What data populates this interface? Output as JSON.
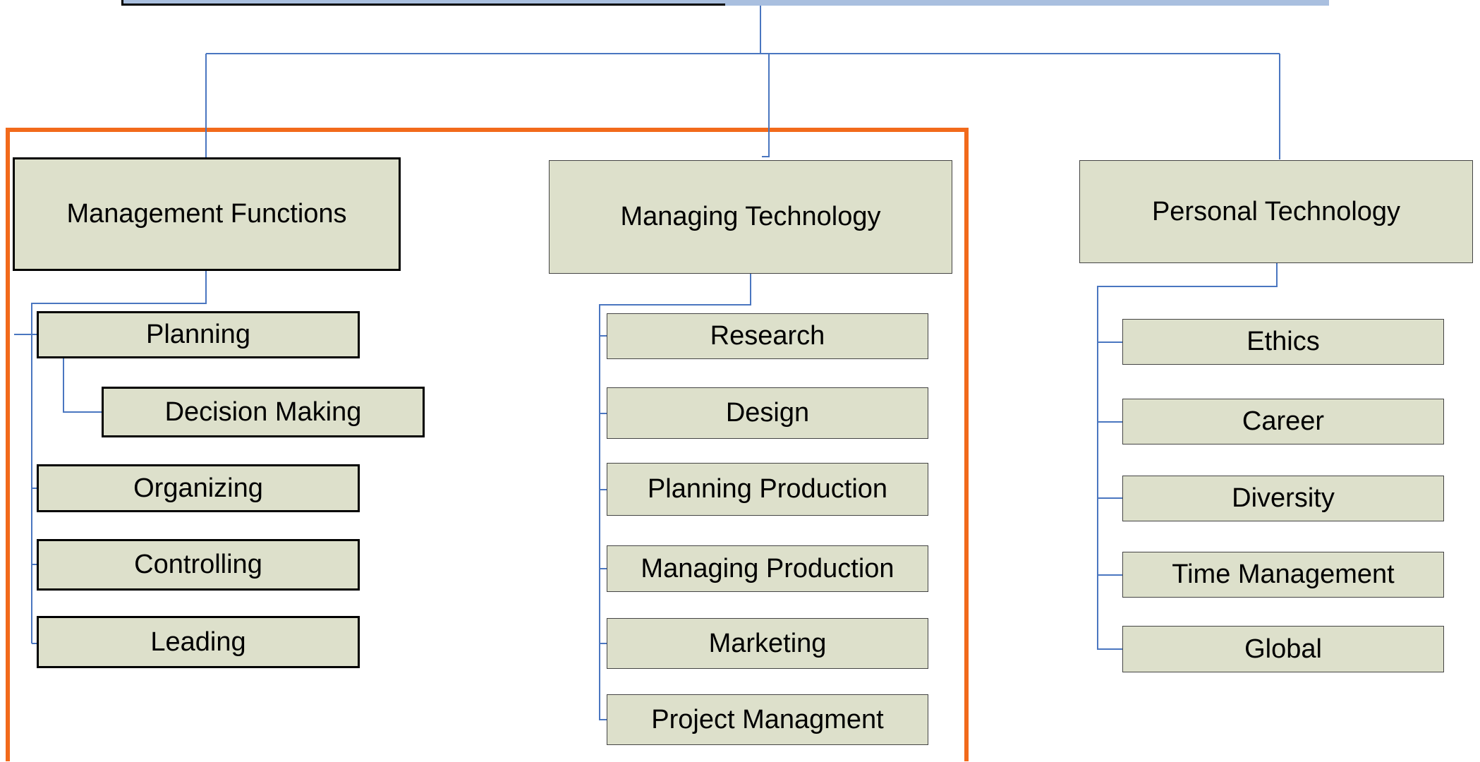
{
  "branches": [
    {
      "title": "Management Functions",
      "items": [
        "Planning",
        "Decision Making",
        "Organizing",
        "Controlling",
        "Leading"
      ]
    },
    {
      "title": "Managing Technology",
      "items": [
        "Research",
        "Design",
        "Planning Production",
        "Managing Production",
        "Marketing",
        "Project Managment"
      ]
    },
    {
      "title": "Personal Technology",
      "items": [
        "Ethics",
        "Career",
        "Diversity",
        "Time Management",
        "Global"
      ]
    }
  ],
  "colors": {
    "connector": "#4a76c0",
    "box_fill": "#dde0cb",
    "highlight": "#f26a1b",
    "top_bar": "#a9bfdf"
  }
}
